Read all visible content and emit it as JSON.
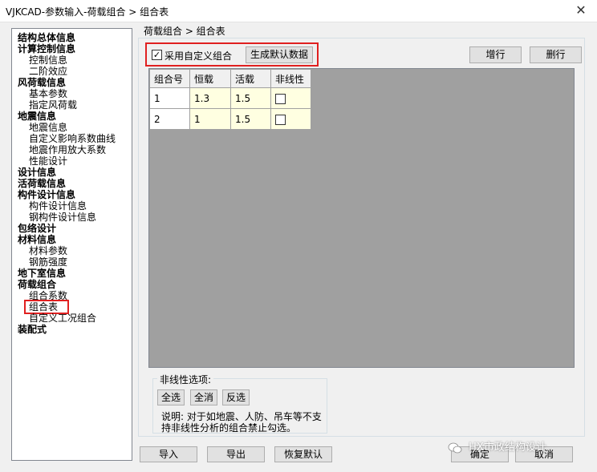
{
  "window": {
    "title": "VJKCAD-参数输入-荷载组合 > 组合表",
    "close_glyph": "✕"
  },
  "tree": {
    "items": [
      {
        "label": "结构总体信息",
        "level": 0
      },
      {
        "label": "计算控制信息",
        "level": 0
      },
      {
        "label": "控制信息",
        "level": 1
      },
      {
        "label": "二阶效应",
        "level": 1
      },
      {
        "label": "风荷载信息",
        "level": 0
      },
      {
        "label": "基本参数",
        "level": 1
      },
      {
        "label": "指定风荷载",
        "level": 1
      },
      {
        "label": "地震信息",
        "level": 0
      },
      {
        "label": "地震信息",
        "level": 1
      },
      {
        "label": "自定义影响系数曲线",
        "level": 1
      },
      {
        "label": "地震作用放大系数",
        "level": 1
      },
      {
        "label": "性能设计",
        "level": 1
      },
      {
        "label": "设计信息",
        "level": 0
      },
      {
        "label": "活荷载信息",
        "level": 0
      },
      {
        "label": "构件设计信息",
        "level": 0
      },
      {
        "label": "构件设计信息",
        "level": 1
      },
      {
        "label": "钢构件设计信息",
        "level": 1
      },
      {
        "label": "包络设计",
        "level": 0
      },
      {
        "label": "材料信息",
        "level": 0
      },
      {
        "label": "材料参数",
        "level": 1
      },
      {
        "label": "钢筋强度",
        "level": 1
      },
      {
        "label": "地下室信息",
        "level": 0
      },
      {
        "label": "荷载组合",
        "level": 0
      },
      {
        "label": "组合系数",
        "level": 1
      },
      {
        "label": "组合表",
        "level": 1,
        "selected": true
      },
      {
        "label": "自定义工况组合",
        "level": 1
      },
      {
        "label": "装配式",
        "level": 0
      }
    ]
  },
  "panel": {
    "breadcrumb": "荷载组合 > 组合表",
    "custom_combo_label": "采用自定义组合",
    "custom_combo_checked": true,
    "generate_default_label": "生成默认数据",
    "add_row_label": "增行",
    "delete_row_label": "删行"
  },
  "grid": {
    "columns": [
      "组合号",
      "恒载",
      "活载",
      "非线性"
    ],
    "rows": [
      {
        "id": "1",
        "dead": "1.3",
        "live": "1.5",
        "nonlinear": false
      },
      {
        "id": "2",
        "dead": "1",
        "live": "1.5",
        "nonlinear": false
      }
    ]
  },
  "nonlinear_options": {
    "title": "非线性选项:",
    "select_all": "全选",
    "deselect_all": "全消",
    "invert": "反选",
    "note": "说明: 对于如地震、人防、吊车等不支持非线性分析的组合禁止勾选。"
  },
  "footer": {
    "import_label": "导入",
    "export_label": "导出",
    "restore_label": "恢复默认",
    "ok_label": "确定",
    "cancel_label": "取消"
  },
  "watermark": {
    "text": "HX市政结构设计"
  },
  "colors": {
    "highlight": "#e02020",
    "cell_bg": "#ffffe1",
    "grid_bg": "#a0a0a0"
  }
}
